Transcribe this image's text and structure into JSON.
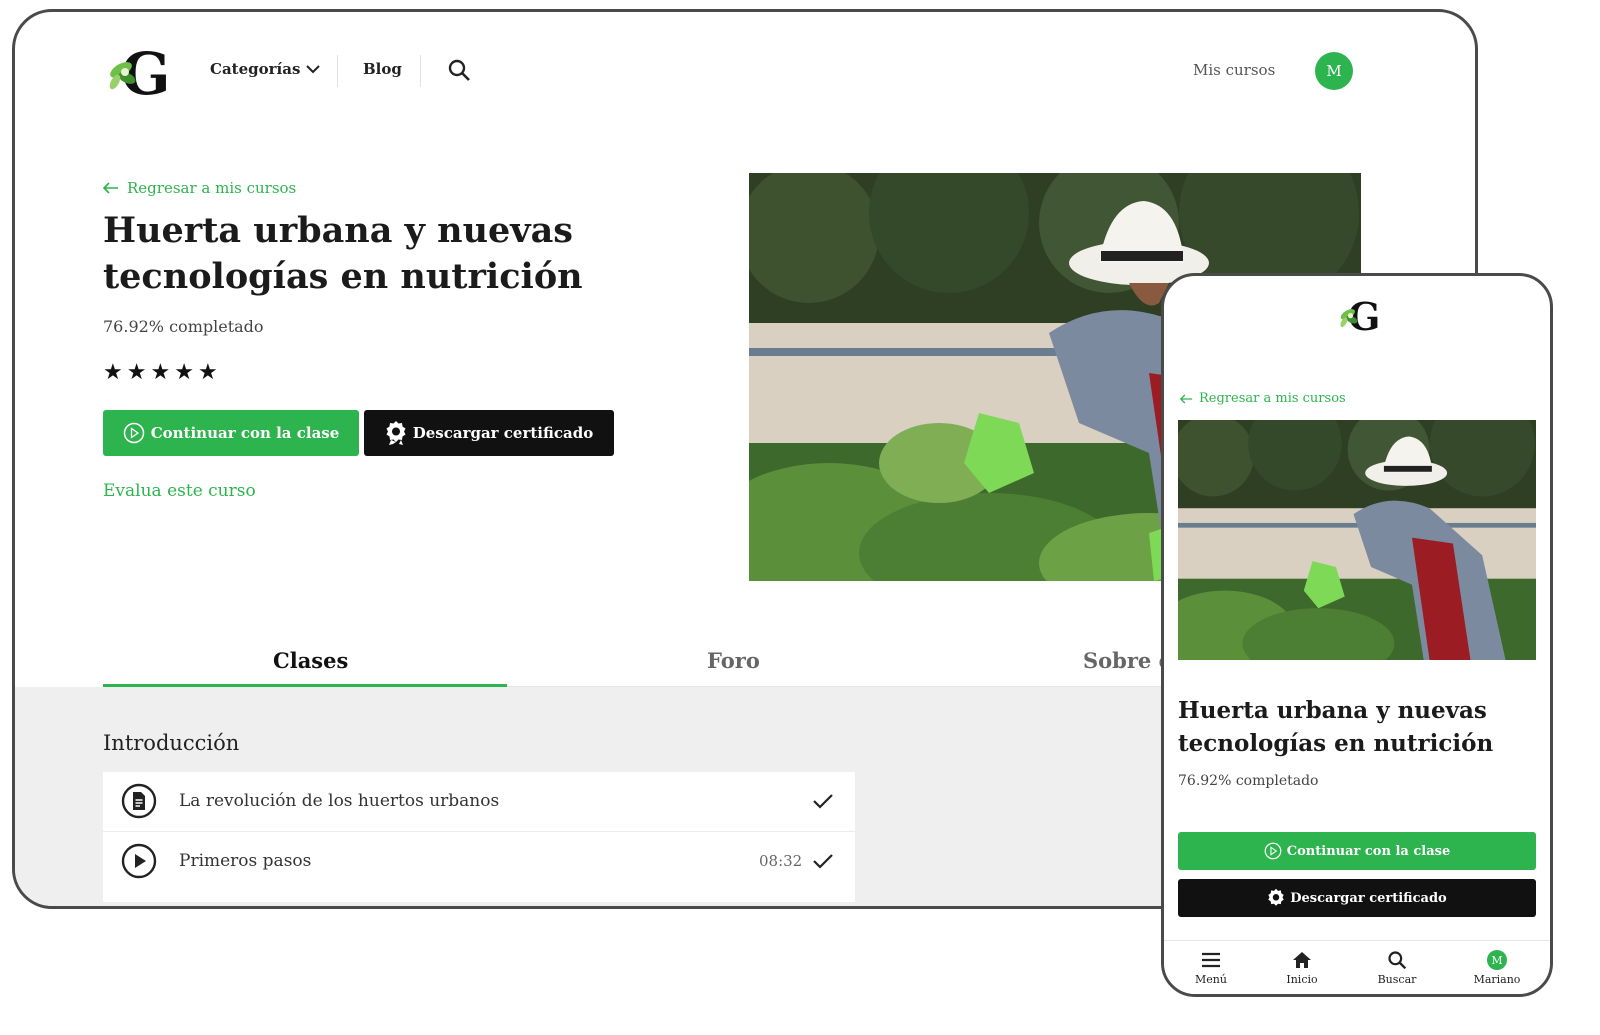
{
  "colors": {
    "accent": "#2db44e",
    "dark_button": "#111111",
    "frame": "#4a4a4a",
    "content_bg": "#efefef"
  },
  "desktop": {
    "header": {
      "logo_icon": "leaf-g-logo",
      "categories_label": "Categorías",
      "blog_label": "Blog",
      "search_icon": "search-icon",
      "my_courses_label": "Mis cursos",
      "avatar_initial": "M"
    },
    "course": {
      "back_label": "Regresar a mis cursos",
      "title": "Huerta urbana y nuevas tecnologías en nutrición",
      "progress_text": "76.92% completado",
      "rating_stars": 5,
      "continue_label": "Continuar con la clase",
      "certificate_label": "Descargar certificado",
      "rate_label": "Evalua este curso"
    },
    "tabs": [
      {
        "label": "Clases",
        "active": true
      },
      {
        "label": "Foro",
        "active": false
      },
      {
        "label": "Sobre el",
        "active": false
      }
    ],
    "section": {
      "title": "Introducción",
      "lessons": [
        {
          "icon": "document-icon",
          "title": "La revolución de los huertos urbanos",
          "duration": "",
          "completed": true
        },
        {
          "icon": "play-icon",
          "title": "Primeros pasos",
          "duration": "08:32",
          "completed": true
        }
      ]
    }
  },
  "mobile": {
    "back_label": "Regresar a mis cursos",
    "title": "Huerta urbana y nuevas tecnologías en nutrición",
    "progress_text": "76.92% completado",
    "continue_label": "Continuar con la clase",
    "certificate_label": "Descargar certificado",
    "bottom_nav": [
      {
        "icon": "menu-icon",
        "label": "Menú"
      },
      {
        "icon": "home-icon",
        "label": "Inicio"
      },
      {
        "icon": "search-icon",
        "label": "Buscar"
      },
      {
        "icon": "avatar",
        "label": "Mariano",
        "initial": "M"
      }
    ]
  }
}
